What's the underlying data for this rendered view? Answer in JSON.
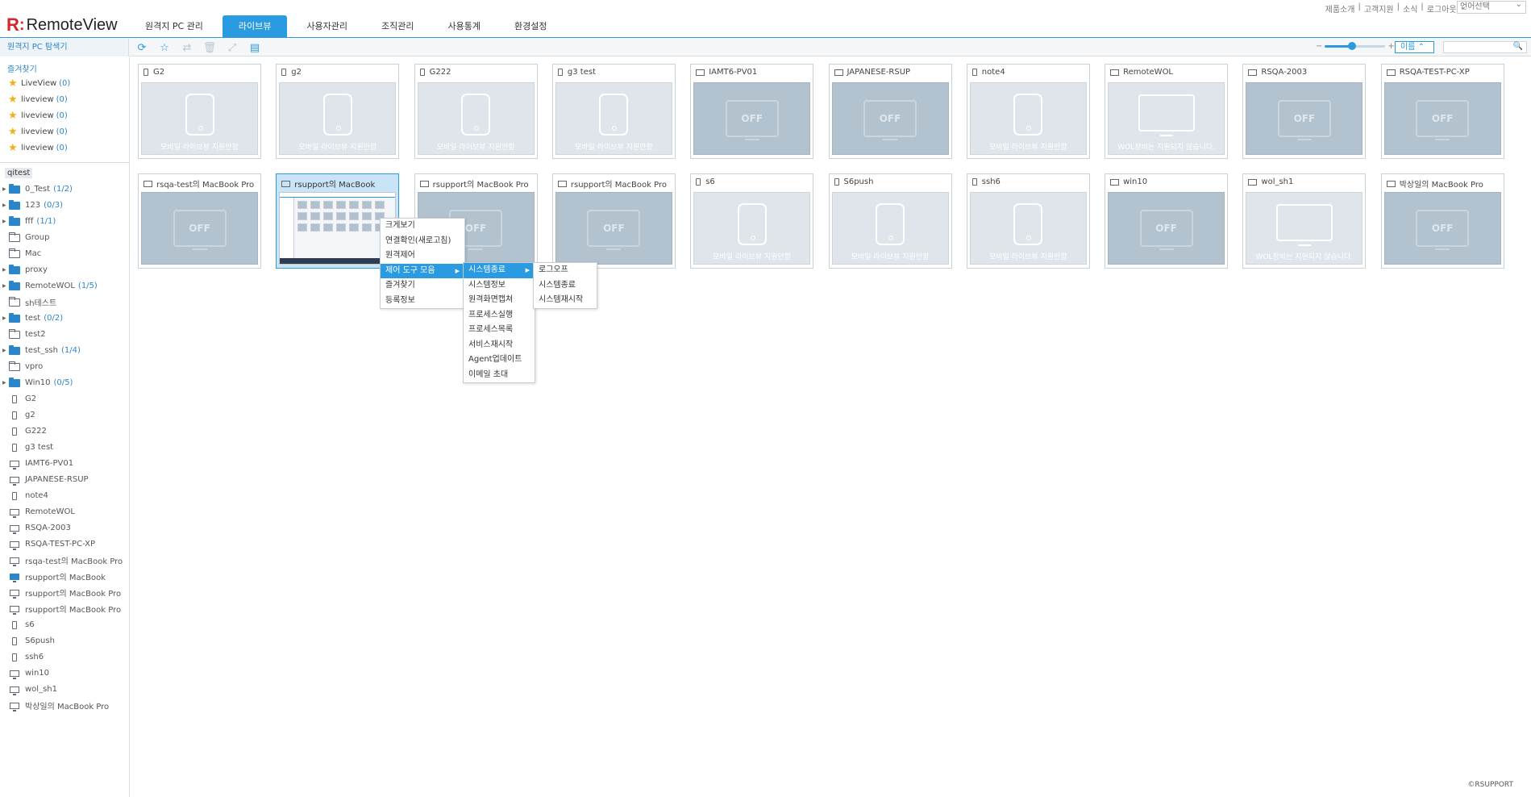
{
  "app": {
    "logo_r": "R",
    "logo_colon": ":",
    "logo_text": "RemoteView",
    "brand_color": "#2a9be0",
    "logo_color": "#d6262b"
  },
  "nav": {
    "tabs": [
      {
        "label": "원격지 PC 관리"
      },
      {
        "label": "라이브뷰",
        "active": true
      },
      {
        "label": "사용자관리"
      },
      {
        "label": "조직관리"
      },
      {
        "label": "사용통계"
      },
      {
        "label": "환경설정"
      }
    ]
  },
  "toplinks": [
    "제품소개",
    "|",
    "고객지원",
    "|",
    "소식",
    "|",
    "로그아웃",
    "⌄"
  ],
  "language": {
    "selected": "언어선택"
  },
  "sidebar_header": "원격지 PC 탐색기",
  "toolbar": {
    "icons": [
      "refresh-icon",
      "star-add-icon",
      "swap-icon",
      "trash-icon",
      "export-icon",
      "report-icon"
    ],
    "zoom_minus": "−",
    "zoom_plus": "+",
    "zoom_level": 0.45,
    "sort_label": "이름 ⌃",
    "search_icon": "🔍"
  },
  "favorites": {
    "title": "즐겨찾기",
    "items": [
      {
        "label": "LiveView",
        "count": "(0)"
      },
      {
        "label": "liveview",
        "count": "(0)"
      },
      {
        "label": "liveview",
        "count": "(0)"
      },
      {
        "label": "liveview",
        "count": "(0)"
      },
      {
        "label": "liveview",
        "count": "(0)"
      }
    ]
  },
  "group_tag": "qitest",
  "tree": [
    {
      "label": "0_Test",
      "count": "(1/2)",
      "type": "folder-filled",
      "arrow": true
    },
    {
      "label": "123",
      "count": "(0/3)",
      "type": "folder-filled",
      "arrow": true
    },
    {
      "label": "fff",
      "count": "(1/1)",
      "type": "folder-filled",
      "arrow": true
    },
    {
      "label": "Group",
      "count": "",
      "type": "folder-empty"
    },
    {
      "label": "Mac",
      "count": "",
      "type": "folder-empty"
    },
    {
      "label": "proxy",
      "count": "",
      "type": "folder-filled",
      "arrow": true
    },
    {
      "label": "RemoteWOL",
      "count": "(1/5)",
      "type": "folder-filled",
      "arrow": true
    },
    {
      "label": "sh테스트",
      "count": "",
      "type": "folder-empty"
    },
    {
      "label": "test",
      "count": "(0/2)",
      "type": "folder-filled",
      "arrow": true
    },
    {
      "label": "test2",
      "count": "",
      "type": "folder-empty"
    },
    {
      "label": "test_ssh",
      "count": "(1/4)",
      "type": "folder-filled",
      "arrow": true
    },
    {
      "label": "vpro",
      "count": "",
      "type": "folder-empty"
    },
    {
      "label": "Win10",
      "count": "(0/5)",
      "type": "folder-filled",
      "arrow": true
    },
    {
      "label": "G2",
      "count": "",
      "type": "mobile"
    },
    {
      "label": "g2",
      "count": "",
      "type": "mobile"
    },
    {
      "label": "G222",
      "count": "",
      "type": "mobile"
    },
    {
      "label": "g3 test",
      "count": "",
      "type": "mobile"
    },
    {
      "label": "IAMT6-PV01",
      "count": "",
      "type": "monitor"
    },
    {
      "label": "JAPANESE-RSUP",
      "count": "",
      "type": "monitor"
    },
    {
      "label": "note4",
      "count": "",
      "type": "mobile"
    },
    {
      "label": "RemoteWOL",
      "count": "",
      "type": "monitor"
    },
    {
      "label": "RSQA-2003",
      "count": "",
      "type": "monitor"
    },
    {
      "label": "RSQA-TEST-PC-XP",
      "count": "",
      "type": "monitor"
    },
    {
      "label": "rsqa-test의 MacBook Pro",
      "count": "",
      "type": "monitor"
    },
    {
      "label": "rsupport의 MacBook",
      "count": "",
      "type": "monitor-sel"
    },
    {
      "label": "rsupport의 MacBook Pro",
      "count": "",
      "type": "monitor"
    },
    {
      "label": "rsupport의 MacBook Pro",
      "count": "",
      "type": "monitor"
    },
    {
      "label": "s6",
      "count": "",
      "type": "mobile"
    },
    {
      "label": "S6push",
      "count": "",
      "type": "mobile"
    },
    {
      "label": "ssh6",
      "count": "",
      "type": "mobile"
    },
    {
      "label": "win10",
      "count": "",
      "type": "monitor"
    },
    {
      "label": "wol_sh1",
      "count": "",
      "type": "monitor"
    },
    {
      "label": "박상일의 MacBook Pro",
      "count": "",
      "type": "monitor"
    }
  ],
  "cards": [
    {
      "name": "G2",
      "kind": "mobile",
      "status": "mob",
      "msg": "모바일 라이브뷰 지원안함"
    },
    {
      "name": "g2",
      "kind": "mobile",
      "status": "mob",
      "msg": "모바일 라이브뷰 지원안함"
    },
    {
      "name": "G222",
      "kind": "mobile",
      "status": "mob",
      "msg": "모바일 라이브뷰 지원안함"
    },
    {
      "name": "g3 test",
      "kind": "mobile",
      "status": "mob",
      "msg": "모바일 라이브뷰 지원안함"
    },
    {
      "name": "IAMT6-PV01",
      "kind": "pc",
      "status": "off",
      "msg": "OFF"
    },
    {
      "name": "JAPANESE-RSUP",
      "kind": "pc",
      "status": "off",
      "msg": "OFF"
    },
    {
      "name": "note4",
      "kind": "mobile",
      "status": "mob",
      "msg": "모바일 라이브뷰 지원안함"
    },
    {
      "name": "RemoteWOL",
      "kind": "pc",
      "status": "wol",
      "msg": "WOL장비는 지원되지 않습니다."
    },
    {
      "name": "RSQA-2003",
      "kind": "pc",
      "status": "off",
      "msg": "OFF"
    },
    {
      "name": "RSQA-TEST-PC-XP",
      "kind": "pc",
      "status": "off",
      "msg": "OFF"
    },
    {
      "name": "rsqa-test의 MacBook Pro",
      "kind": "pc",
      "status": "off",
      "msg": "OFF"
    },
    {
      "name": "rsupport의 MacBook",
      "kind": "pc",
      "status": "screen",
      "msg": "",
      "selected": true
    },
    {
      "name": "rsupport의 MacBook Pro",
      "kind": "pc",
      "status": "off",
      "msg": "OFF"
    },
    {
      "name": "rsupport의 MacBook Pro",
      "kind": "pc",
      "status": "off",
      "msg": "OFF"
    },
    {
      "name": "s6",
      "kind": "mobile",
      "status": "mob",
      "msg": "모바일 라이브뷰 지원안함"
    },
    {
      "name": "S6push",
      "kind": "mobile",
      "status": "mob",
      "msg": "모바일 라이브뷰 지원안함"
    },
    {
      "name": "ssh6",
      "kind": "mobile",
      "status": "mob",
      "msg": "모바일 라이브뷰 지원안함"
    },
    {
      "name": "win10",
      "kind": "pc",
      "status": "off",
      "msg": "OFF"
    },
    {
      "name": "wol_sh1",
      "kind": "pc",
      "status": "wol",
      "msg": "WOL장비는 지원되지 않습니다."
    },
    {
      "name": "박상일의 MacBook Pro",
      "kind": "pc",
      "status": "off",
      "msg": "OFF"
    }
  ],
  "context_menu": {
    "items": [
      {
        "label": "크게보기"
      },
      {
        "label": "연결확인(새로고침)"
      },
      {
        "label": "원격제어"
      },
      {
        "label": "제어 도구 모음",
        "highlight": true,
        "submenu": true
      },
      {
        "label": "즐겨찾기"
      },
      {
        "label": "등록정보"
      }
    ]
  },
  "submenu": {
    "items": [
      {
        "label": "시스템종료",
        "highlight": true,
        "submenu": true
      },
      {
        "label": "시스템정보"
      },
      {
        "label": "원격화면캡쳐"
      },
      {
        "label": "프로세스실행"
      },
      {
        "label": "프로세스목록"
      },
      {
        "label": "서비스재시작"
      },
      {
        "label": "Agent업데이트"
      },
      {
        "label": "이메일 초대"
      }
    ]
  },
  "submenu2": {
    "items": [
      {
        "label": "로그오프"
      },
      {
        "label": "시스템종료"
      },
      {
        "label": "시스템재시작"
      }
    ]
  },
  "copyright": "©RSUPPORT"
}
